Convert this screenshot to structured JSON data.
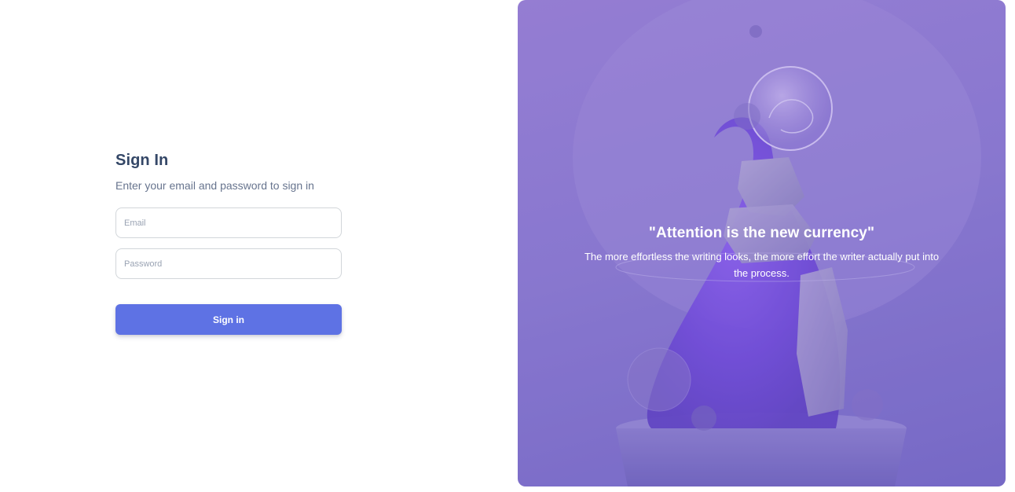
{
  "signin": {
    "title": "Sign In",
    "subtitle": "Enter your email and password to sign in",
    "email_placeholder": "Email",
    "password_placeholder": "Password",
    "button_label": "Sign in"
  },
  "panel": {
    "quote_title": "\"Attention is the new currency\"",
    "quote_body": "The more effortless the writing looks, the more effort the writer actually put into the process."
  },
  "colors": {
    "primary": "#5e72e4",
    "heading": "#344767",
    "panel_overlay": "#8b7bd0"
  }
}
